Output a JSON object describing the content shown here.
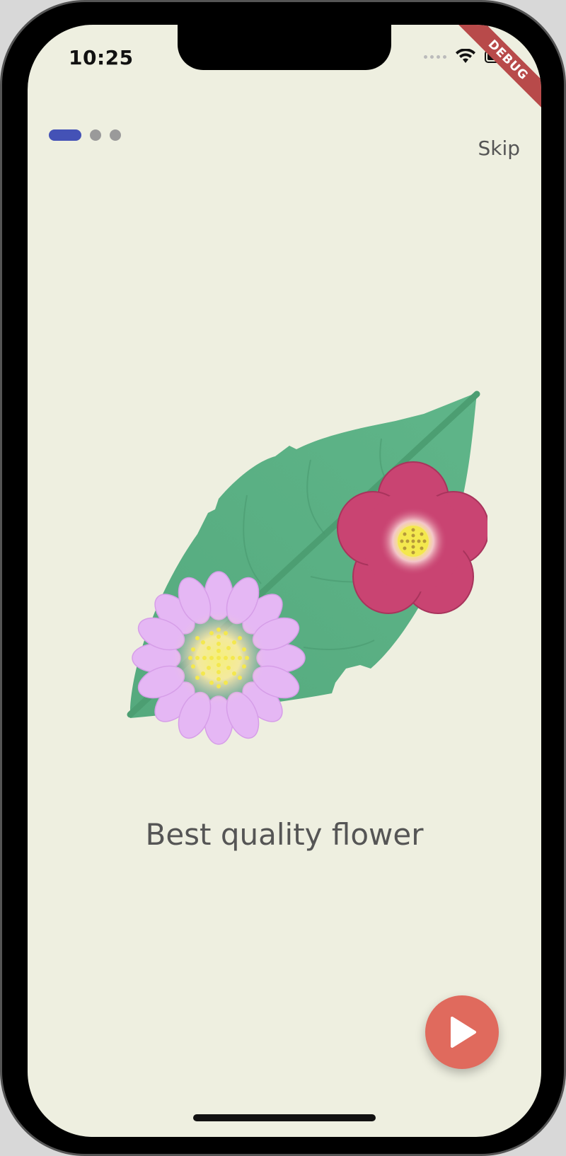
{
  "status_bar": {
    "time": "10:25"
  },
  "debug_banner": "DEBUG",
  "onboarding": {
    "page_indicator": {
      "current": 1,
      "total": 3
    },
    "skip_label": "Skip",
    "headline": "Best quality flower"
  },
  "icons": {
    "wifi": "wifi-icon",
    "battery": "battery-icon",
    "next": "play-arrow-icon"
  },
  "colors": {
    "background": "#eeefe0",
    "indicator_active": "#4452b6",
    "indicator_inactive": "#9a9a9a",
    "next_button": "#e06a5d",
    "leaf": "#5fb286",
    "flower_pink": "#c94472",
    "flower_lilac": "#e5b7f4",
    "flower_center": "#f4e84e"
  }
}
